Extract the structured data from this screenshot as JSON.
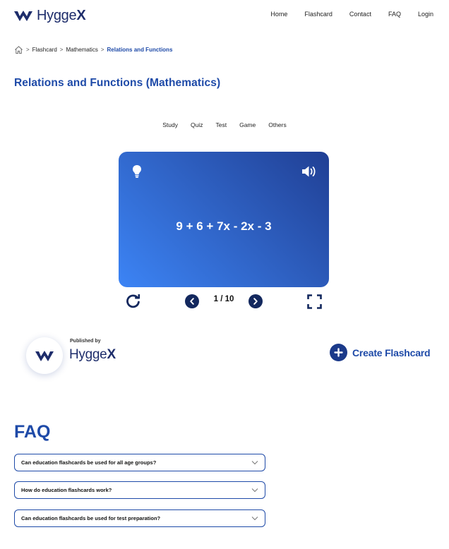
{
  "brand": {
    "name_light": "Hygge",
    "name_bold": "X"
  },
  "nav": [
    {
      "label": "Home"
    },
    {
      "label": "Flashcard"
    },
    {
      "label": "Contact"
    },
    {
      "label": "FAQ"
    },
    {
      "label": "Login"
    }
  ],
  "breadcrumb": {
    "items": [
      "Flashcard",
      "Mathematics"
    ],
    "current": "Relations and Functions",
    "separator": ">"
  },
  "page": {
    "title": "Relations and Functions (Mathematics)"
  },
  "tabs": [
    "Study",
    "Quiz",
    "Test",
    "Game",
    "Others"
  ],
  "flashcard": {
    "text": "9 + 6 + 7x - 2x - 3",
    "counter": "1 / 10",
    "gradient_start": "#3c84f5",
    "gradient_end": "#203f94"
  },
  "publisher": {
    "label": "Published by",
    "name_light": "Hygge",
    "name_bold": "X"
  },
  "create": {
    "label": "Create Flashcard"
  },
  "faq": {
    "title": "FAQ",
    "items": [
      {
        "question": "Can education flashcards be used for all age groups?"
      },
      {
        "question": "How do education flashcards work?"
      },
      {
        "question": "Can education flashcards be used for test preparation?"
      }
    ]
  },
  "colors": {
    "accent": "#1e4aa8",
    "dark_navy": "#13285e"
  },
  "icons": [
    "logo-icon",
    "home-icon",
    "lightbulb-icon",
    "speaker-icon",
    "restart-icon",
    "chevron-left-icon",
    "chevron-right-icon",
    "fullscreen-icon",
    "plus-icon",
    "chevron-down-icon"
  ]
}
